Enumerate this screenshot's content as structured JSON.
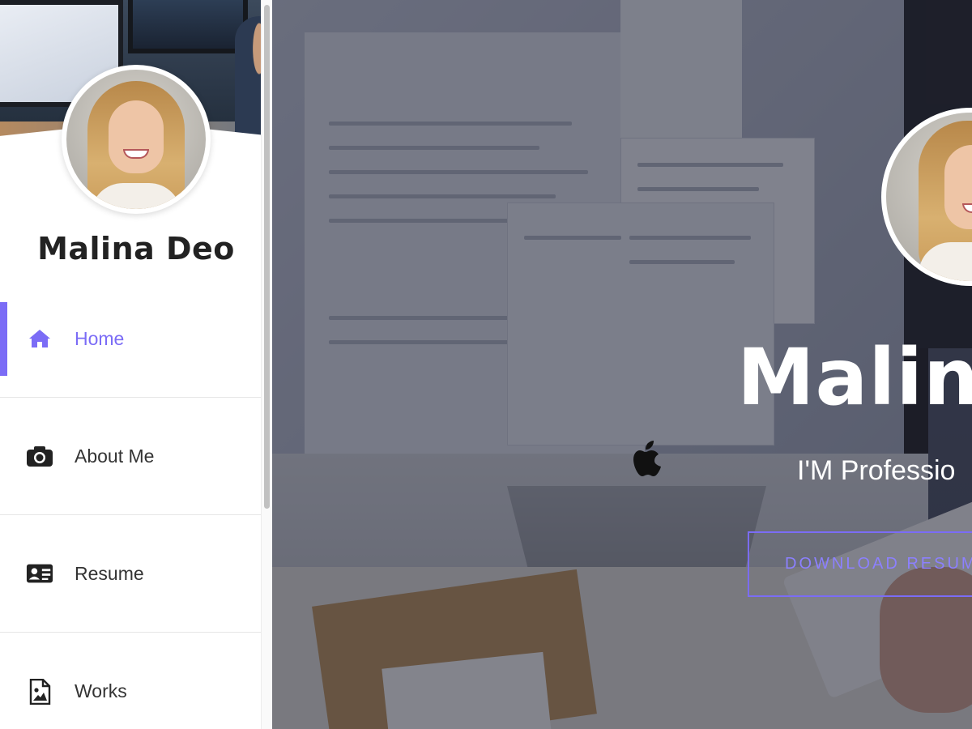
{
  "profile": {
    "name": "Malina Deo"
  },
  "nav": {
    "items": [
      {
        "label": "Home",
        "icon": "home-icon",
        "active": true
      },
      {
        "label": "About Me",
        "icon": "camera-icon",
        "active": false
      },
      {
        "label": "Resume",
        "icon": "id-card-icon",
        "active": false
      },
      {
        "label": "Works",
        "icon": "image-file-icon",
        "active": false
      }
    ]
  },
  "hero": {
    "title": "Malin",
    "tagline": "I'M Professio",
    "download_label": "DOWNLOAD RESUM"
  },
  "colors": {
    "accent": "#7b6cf6",
    "text_dark": "#222222",
    "white": "#ffffff"
  }
}
